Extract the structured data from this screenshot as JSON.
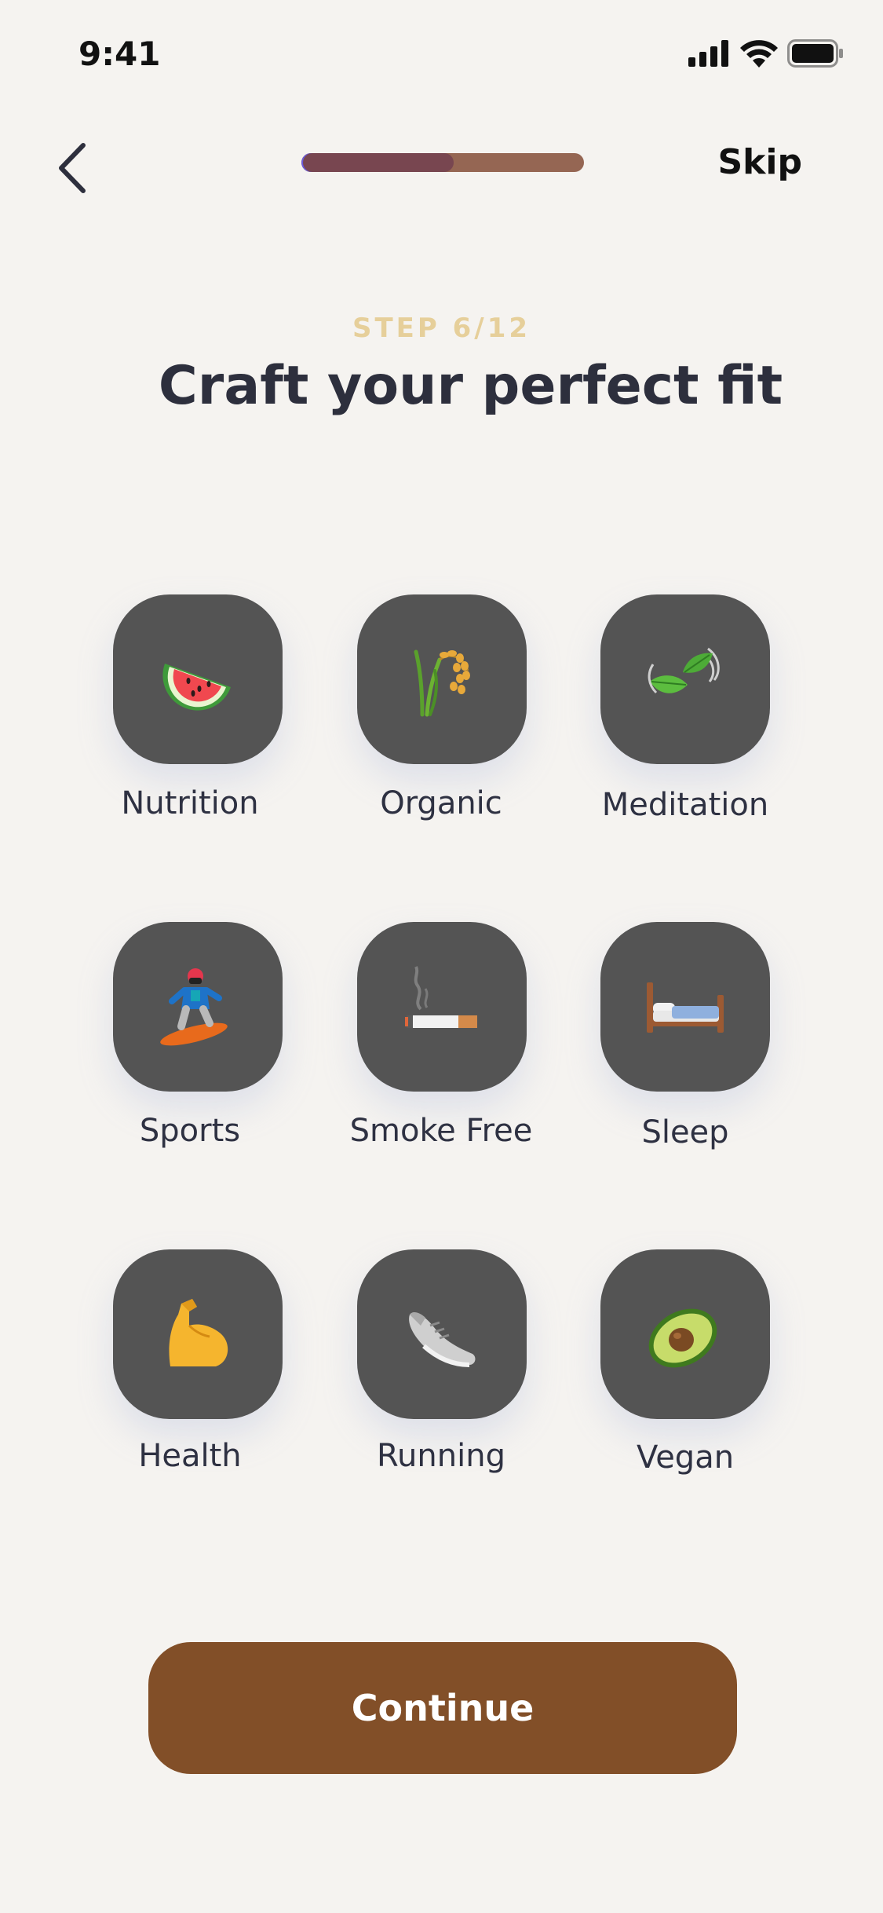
{
  "status_bar": {
    "time": "9:41",
    "icons": [
      "cellular-signal-icon",
      "wifi-icon",
      "battery-icon"
    ]
  },
  "nav": {
    "back_icon": "chevron-left-icon",
    "progress": 0.54,
    "skip_label": "Skip"
  },
  "header": {
    "step": "STEP 6/12",
    "title": "Craft your perfect fit"
  },
  "categories": [
    {
      "label": "Nutrition",
      "icon": "watermelon-icon"
    },
    {
      "label": "Organic",
      "icon": "rice-plant-icon"
    },
    {
      "label": "Meditation",
      "icon": "leaves-icon"
    },
    {
      "label": "Sports",
      "icon": "snowboarder-icon"
    },
    {
      "label": "Smoke Free",
      "icon": "cigarette-icon"
    },
    {
      "label": "Sleep",
      "icon": "bed-icon"
    },
    {
      "label": "Health",
      "icon": "flexed-biceps-icon"
    },
    {
      "label": "Running",
      "icon": "running-shoe-icon"
    },
    {
      "label": "Vegan",
      "icon": "avocado-icon"
    }
  ],
  "footer": {
    "continue_label": "Continue"
  },
  "colors": {
    "background": "#f5f3f0",
    "accent": "#824f28",
    "tile": "#545454",
    "step_label": "#e6cf9a",
    "title": "#2d2f3d"
  }
}
